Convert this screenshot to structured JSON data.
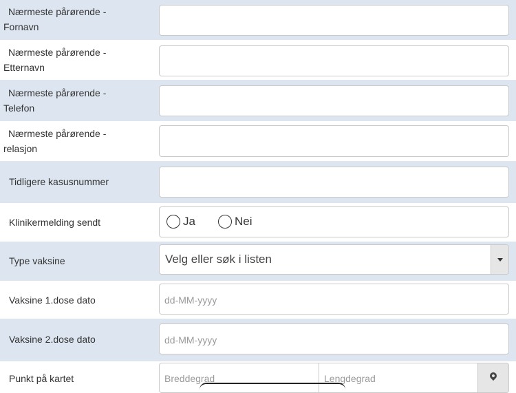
{
  "form": {
    "fornavn": {
      "line1": "Nærmeste pårørende -",
      "line2": "Fornavn",
      "value": ""
    },
    "etternavn": {
      "line1": "Nærmeste pårørende -",
      "line2": "Etternavn",
      "value": ""
    },
    "telefon": {
      "line1": "Nærmeste pårørende -",
      "line2": "Telefon",
      "value": ""
    },
    "relasjon": {
      "line1": "Nærmeste pårørende -",
      "line2": "relasjon",
      "value": ""
    },
    "kasusnummer": {
      "label": "Tidligere kasusnummer",
      "value": ""
    },
    "klinikermelding": {
      "label": "Klinikermelding sendt",
      "options": [
        "Ja",
        "Nei"
      ]
    },
    "type_vaksine": {
      "label": "Type vaksine",
      "selected": "Velg eller søk i listen"
    },
    "dose1": {
      "label": "Vaksine 1.dose dato",
      "placeholder": "dd-MM-yyyy"
    },
    "dose2": {
      "label": "Vaksine 2.dose dato",
      "placeholder": "dd-MM-yyyy"
    },
    "punkt": {
      "label": "Punkt på kartet",
      "lat_placeholder": "Breddegrad",
      "lng_placeholder": "Lengdegrad"
    }
  },
  "icons": {
    "map": "map-marker-icon",
    "dropdown": "caret-down-icon",
    "radio": "radio-circle-icon"
  }
}
